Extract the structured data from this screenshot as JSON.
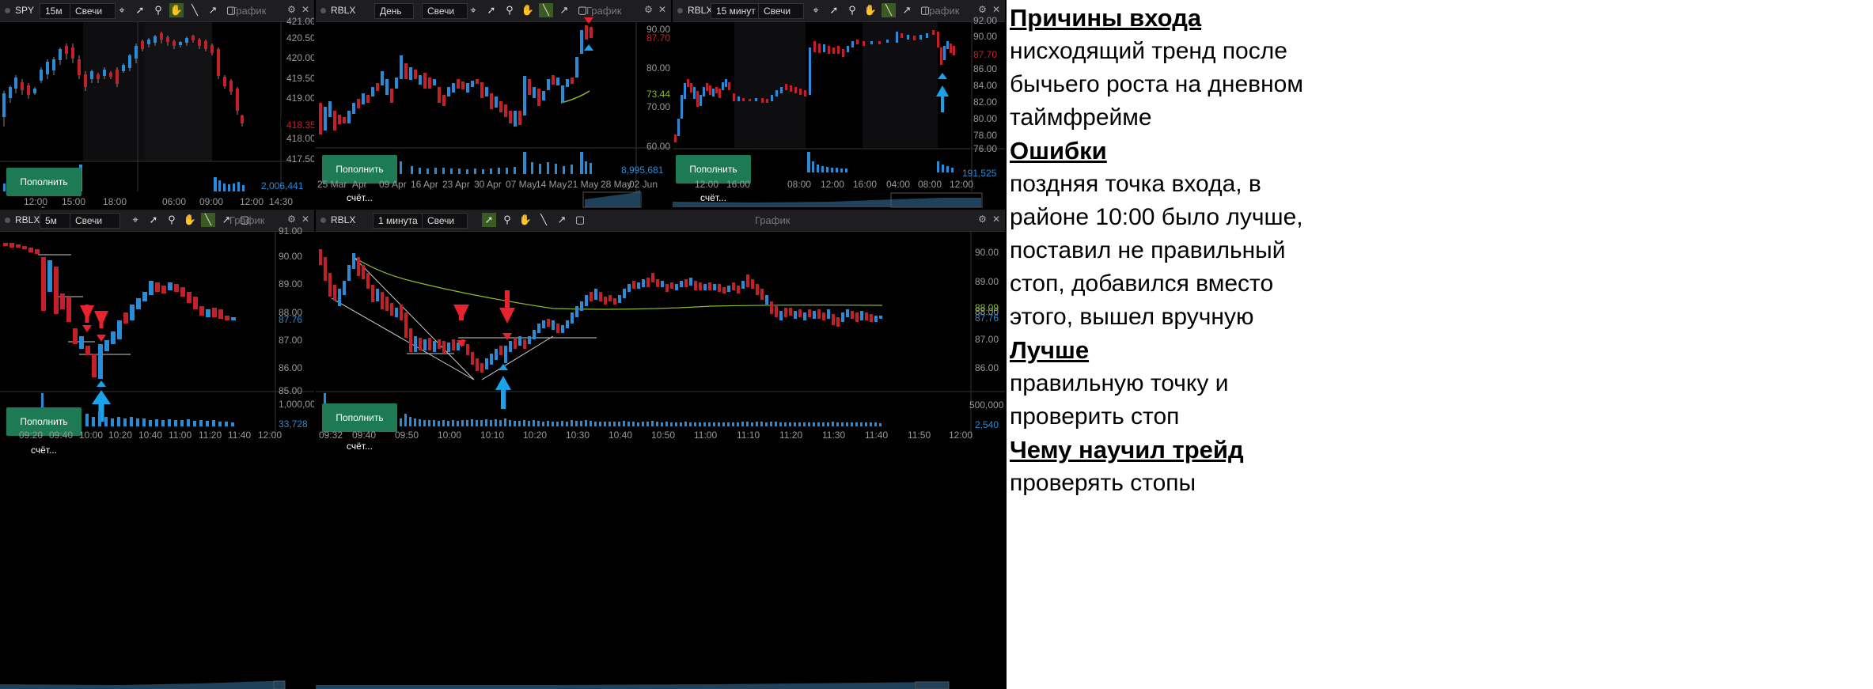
{
  "panels": {
    "spy": {
      "symbol": "SPY",
      "timeframe": "15м",
      "type": "Свечи",
      "title": "График",
      "deposit_button": "Пополнить счёт...",
      "y_ticks": [
        "421.00",
        "420.50",
        "420.00",
        "419.50",
        "419.00",
        "418.50",
        "418.00",
        "417.50"
      ],
      "last_price": "418.35",
      "volume": "2,006,441",
      "x_ticks": [
        "12:00",
        "15:00",
        "18:00",
        "06:00",
        "09:00",
        "12:00",
        "14:30"
      ]
    },
    "rblx_day": {
      "symbol": "RBLX",
      "timeframe": "День",
      "type": "Свечи",
      "title": "График",
      "deposit_button": "Пополнить счёт...",
      "y_ticks": [
        "90.00",
        "80.00",
        "70.00",
        "60.00"
      ],
      "last_price": "87.70",
      "ma_value": "73.44",
      "volume": "8,995,681",
      "x_ticks": [
        "25 Mar",
        "Apr",
        "09 Apr",
        "16 Apr",
        "23 Apr",
        "30 Apr",
        "07 May",
        "14 May",
        "21 May",
        "28 May",
        "02 Jun"
      ]
    },
    "rblx_15m": {
      "symbol": "RBLX",
      "timeframe": "15 минут",
      "type": "Свечи",
      "title": "График",
      "deposit_button": "Пополнить счёт...",
      "y_ticks": [
        "92.00",
        "90.00",
        "88.00",
        "86.00",
        "84.00",
        "82.00",
        "80.00",
        "78.00",
        "76.00"
      ],
      "last_price": "87.70",
      "volume": "191,525",
      "x_ticks": [
        "12:00",
        "16:00",
        "08:00",
        "12:00",
        "16:00",
        "04:00",
        "08:00",
        "12:00"
      ]
    },
    "rblx_5m": {
      "symbol": "RBLX",
      "timeframe": "5м",
      "type": "Свечи",
      "title": "График",
      "deposit_button": "Пополнить счёт...",
      "y_ticks": [
        "91.00",
        "90.00",
        "89.00",
        "88.00",
        "87.00",
        "86.00",
        "85.00"
      ],
      "last_price": "87.76",
      "volume_ticks": [
        "1,000,000"
      ],
      "volume": "33,728",
      "x_ticks": [
        "09:20",
        "09:40",
        "10:00",
        "10:20",
        "10:40",
        "11:00",
        "11:20",
        "11:40",
        "12:00"
      ]
    },
    "rblx_1m": {
      "symbol": "RBLX",
      "timeframe": "1 минута",
      "type": "Свечи",
      "title": "График",
      "deposit_button": "Пополнить счёт...",
      "y_ticks": [
        "90.00",
        "89.00",
        "88.00",
        "87.00",
        "86.00"
      ],
      "ma_value": "88.09",
      "last_price": "87.76",
      "volume_ticks": [
        "500,000"
      ],
      "volume": "2,540",
      "x_ticks": [
        "09:32",
        "09:40",
        "09:50",
        "10:00",
        "10:10",
        "10:20",
        "10:30",
        "10:40",
        "10:50",
        "11:00",
        "11:10",
        "11:20",
        "11:30",
        "11:40",
        "11:50",
        "12:00"
      ]
    }
  },
  "colors": {
    "up": "#2a8bd6",
    "down": "#c4202a",
    "ma": "#8dbb2a",
    "arrow_red": "#e8232d",
    "arrow_blue": "#1aa3ea",
    "button": "#1e7a55"
  },
  "notes": {
    "h1": "Причины входа",
    "t1": [
      "нисходящий тренд после",
      "бычьего роста на дневном",
      "таймфрейме"
    ],
    "h2": "Ошибки",
    "t2": [
      "поздняя точка входа, в",
      "районе 10:00 было лучше,",
      "поставил не правильный",
      "стоп, добавился вместо",
      "этого, вышел вручную"
    ],
    "h3": "Лучше",
    "t3": [
      "правильную точку и",
      "проверить стоп"
    ],
    "h4": "Чему научил трейд",
    "t4": [
      "проверять стопы"
    ]
  }
}
